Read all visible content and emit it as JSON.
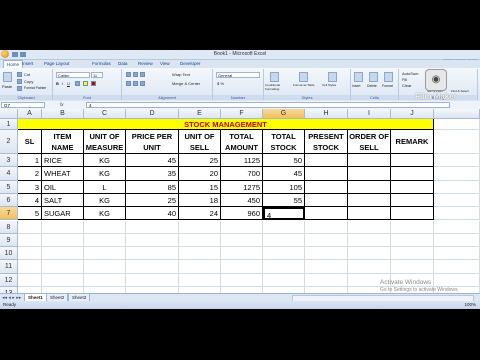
{
  "window": {
    "title": "Book1 - Microsoft Excel"
  },
  "tabs": [
    "Home",
    "Insert",
    "Page Layout",
    "Formulas",
    "Data",
    "Review",
    "View",
    "Developer"
  ],
  "ribbon": {
    "font_name": "Calibri",
    "font_size": "11",
    "groups": [
      "Clipboard",
      "Font",
      "Alignment",
      "Number",
      "Styles",
      "Cells",
      "Editing"
    ],
    "cut": "Cut",
    "copy": "Copy",
    "format_painter": "Format Painter",
    "paste": "Paste",
    "wrap_text": "Wrap Text",
    "merge_center": "Merge & Center",
    "number_format": "General",
    "cond_format": "Conditional Formatting",
    "format_table": "Format as Table",
    "cell_styles": "Cell Styles",
    "insert": "Insert",
    "delete": "Delete",
    "format": "Format",
    "autosum": "AutoSum",
    "fill": "Fill",
    "clear": "Clear",
    "sort_filter": "Sort & Filter",
    "find_select": "Find & Select"
  },
  "formula_bar": {
    "name_box": "G7",
    "fx": "fx",
    "value": "4"
  },
  "columns": [
    "A",
    "B",
    "C",
    "D",
    "E",
    "F",
    "G",
    "H",
    "I",
    "J"
  ],
  "rows": [
    "1",
    "2",
    "3",
    "4",
    "5",
    "6",
    "7",
    "8",
    "9",
    "10",
    "11",
    "12",
    "13"
  ],
  "sheet": {
    "title": "STOCK MANAGEMENT",
    "headers": [
      "SL NO.",
      "ITEM NAME",
      "UNIT OF MEASURE",
      "PRICE PER UNIT",
      "UNIT OF SELL",
      "TOTAL AMOUNT",
      "TOTAL STOCK",
      "PRESENT STOCK",
      "ORDER OF SELL",
      "REMARK"
    ],
    "data": [
      [
        "1",
        "RICE",
        "KG",
        "45",
        "25",
        "1125",
        "50"
      ],
      [
        "2",
        "WHEAT",
        "KG",
        "35",
        "20",
        "700",
        "45"
      ],
      [
        "3",
        "OIL",
        "L",
        "85",
        "15",
        "1275",
        "105"
      ],
      [
        "4",
        "SALT",
        "KG",
        "25",
        "18",
        "450",
        "55"
      ],
      [
        "5",
        "SUGAR",
        "KG",
        "40",
        "24",
        "960",
        "4"
      ]
    ]
  },
  "sheet_tabs": [
    "Sheet1",
    "Sheet2",
    "Sheet3"
  ],
  "status": {
    "ready": "Ready",
    "zoom": "100%"
  },
  "watermarks": {
    "film_maker": "Film Maker",
    "activate_title": "Activate Windows",
    "activate_sub": "Go to Settings to activate Windows."
  }
}
